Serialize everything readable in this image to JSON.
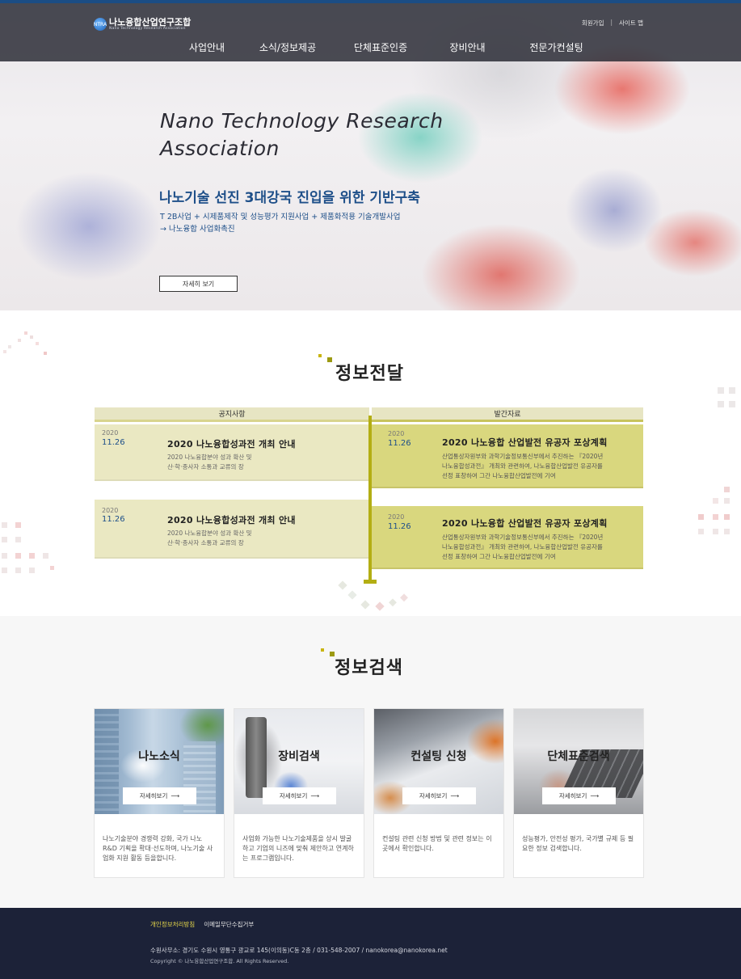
{
  "header": {
    "logo_ko": "나노융합산업연구조합",
    "logo_en": "Nano Technology Research Association",
    "logo_mark": "NTRA",
    "util": {
      "join": "회원가입",
      "separator": "|",
      "sitemap": "사이트 맵"
    },
    "nav": [
      "사업안내",
      "소식/정보제공",
      "단체표준인증",
      "장비안내",
      "전문가컨설팅"
    ]
  },
  "hero": {
    "title_en_line1": "Nano Technology Research",
    "title_en_line2": "Association",
    "title_ko": "나노기술 선진 3대강국 진입을 위한 기반구축",
    "sub_line1": "T 2B사업 + 시제품제작 및 성능평가 지원사업 + 제품화적용 기술개발사업",
    "sub_line2": "→ 나노융합 사업화촉진",
    "button": "자세히 보기"
  },
  "info": {
    "title": "정보전달",
    "left_header": "공지사항",
    "right_header": "발간자료",
    "notices": [
      {
        "year": "2020",
        "date": "11.26",
        "title": "2020 나노융합성과전 개최 안내",
        "desc1": "2020 나노융합분야 성과 확산 및",
        "desc2": "산·학·종사자 소통과 교류의 장"
      },
      {
        "year": "2020",
        "date": "11.26",
        "title": "2020 나노융합성과전 개최 안내",
        "desc1": "2020 나노융합분야 성과 확산 및",
        "desc2": "산·학·종사자 소통과 교류의 장"
      }
    ],
    "publications": [
      {
        "year": "2020",
        "date": "11.26",
        "title": "2020 나노융합 산업발전 유공자 포상계획",
        "desc1": "산업통상자원부와 과학기술정보통신부에서 추진하는 『2020년",
        "desc2": "나노융합성과전』 개최와 관련하여, 나노융합산업발전 유공자를",
        "desc3": "선정 표창하여 그간 나노융합산업발전에 기여"
      },
      {
        "year": "2020",
        "date": "11.26",
        "title": "2020 나노융합 산업발전 유공자 포상계획",
        "desc1": "산업통상자원부와 과학기술정보통신부에서 추진하는 『2020년",
        "desc2": "나노융합성과전』 개최와 관련하여, 나노융합산업발전 유공자를",
        "desc3": "선정 표창하여 그간 나노융합산업발전에 기여"
      }
    ]
  },
  "search": {
    "title": "정보검색",
    "more_label": "자세히보기",
    "arrow": "⟶",
    "boxes": [
      {
        "label": "나노소식",
        "text": "나노기술분야 경쟁력 강화, 국가 나노 R&D 기획을 확대·선도하며, 나노기술 사업화 지원 활동 등을합니다."
      },
      {
        "label": "장비검색",
        "text": "사업화 가능한 나노기술제품을 상시 발굴하고 기업의 니즈에 맞춰 제안하고 연계하는 프로그램입니다."
      },
      {
        "label": "컨설팅 신청",
        "text": "컨설팅 관련 신청 방법 및 관련 정보는 이곳에서 확인합니다."
      },
      {
        "label": "단체표준검색",
        "text": "성능평가, 안전성 평가, 국가별 규제 등 필요한 정보 검색합니다."
      }
    ]
  },
  "footer": {
    "privacy": "개인정보처리방침",
    "email_policy": "이메일무단수집거부",
    "address": "수원사무소: 경기도 수원시 영통구 광교로 145(이의동)C동 2층 / 031-548-2007 / nanokorea@nanokorea.net",
    "copyright": "Copyright © 나노융합산업연구조합. All Rights Reserved."
  },
  "colors": {
    "accent_navy": "#1e4f89",
    "olive": "#b3ae13",
    "footer_bg": "#1c2238",
    "footer_highlight": "#e8d94a"
  }
}
